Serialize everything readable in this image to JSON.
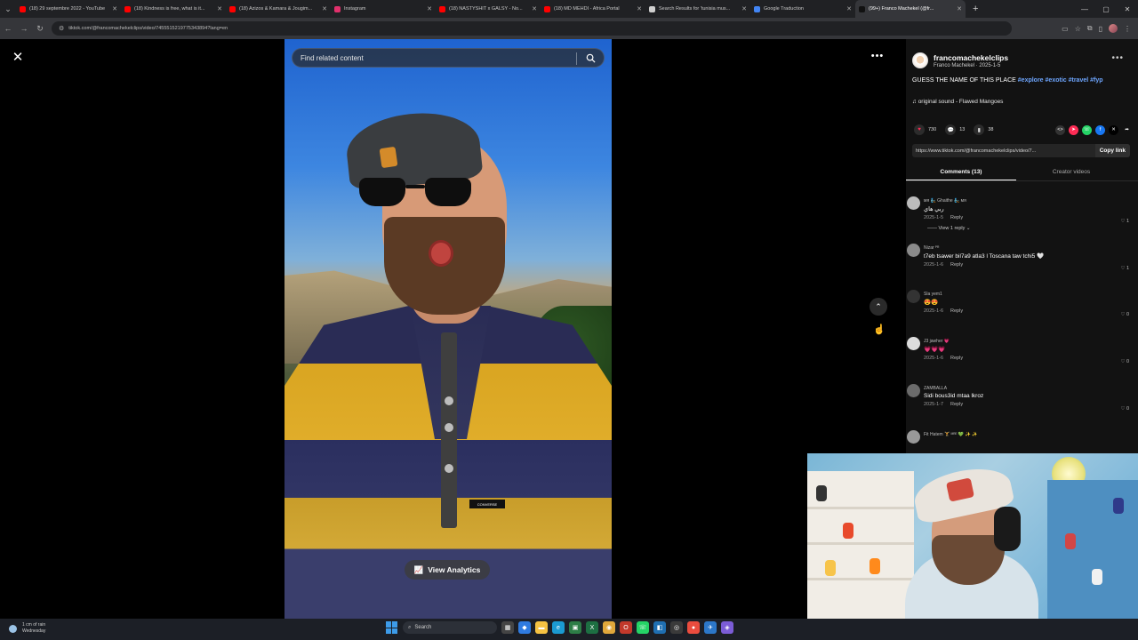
{
  "browser": {
    "tabs": [
      {
        "label": "(18) 29 septembre 2022 - YouTube",
        "color": "#ff0000"
      },
      {
        "label": "(18) Kindness is free, what is it...",
        "color": "#ff0000"
      },
      {
        "label": "(18) Azizos & Kamara & Jougim...",
        "color": "#ff0000"
      },
      {
        "label": "Instagram",
        "color": "#e1306c"
      },
      {
        "label": "(18) NASTYSHIT x GALSY - No...",
        "color": "#ff0000"
      },
      {
        "label": "(18) MD MEHDI - Africa Portal",
        "color": "#ff0000"
      },
      {
        "label": "Search Results for 'tunisia mus...",
        "color": "#cfcfcf"
      },
      {
        "label": "Google Traduction",
        "color": "#4285f4"
      },
      {
        "label": "(99+) Franco Machekel (@fr...",
        "color": "#111111"
      }
    ],
    "active_tab_index": 8,
    "url": "tiktok.com/@francomachekelclips/video/7455515219775343894?lang=en"
  },
  "video": {
    "search_placeholder": "Find related content",
    "analytics_label": "View Analytics",
    "shirt_logo": "CONVERSE"
  },
  "post": {
    "username": "francomachekelclips",
    "author_line": "Franco Machekel · 2025-1-5",
    "caption_text": "GUESS THE NAME OF THIS PLACE ",
    "hashtags": [
      "#explore",
      "#exotic",
      "#travel",
      "#fyp"
    ],
    "sound": "original sound - Flawed Mangoes",
    "likes": "730",
    "comments_count": "13",
    "saves": "38",
    "link": "https://www.tiktok.com/@francomachekelclips/video/7...",
    "copy_label": "Copy link"
  },
  "panel_tabs": {
    "comments": "Comments (13)",
    "creator": "Creator videos"
  },
  "comments": [
    {
      "name": "мя 🧞 Ghaithe 🧞 мя",
      "text": "ربي هاي",
      "date": "2025-1-5",
      "likes": "1",
      "replies": "View 1 reply"
    },
    {
      "name": "Nizar ᴾᴿ",
      "text": "t7eb tsawer bil7a9 atla3 l Toscana taw tchi5 🤍",
      "date": "2025-1-6",
      "likes": "1",
      "replies": ""
    },
    {
      "name": "Sla yem1",
      "text": "😍😍",
      "date": "2025-1-6",
      "likes": "0",
      "replies": ""
    },
    {
      "name": "J3 jawher 💗",
      "text": "💗💗💗",
      "date": "2025-1-6",
      "likes": "0",
      "replies": ""
    },
    {
      "name": "ZAMBALLA",
      "text": "Sidi bous3id mtaa lkroz",
      "date": "2025-1-7",
      "likes": "0",
      "replies": ""
    },
    {
      "name": "Fit Hatem 🏋 ᴹᴿᴱ 💚 ✨ ✨",
      "text": "",
      "date": "",
      "likes": "",
      "replies": ""
    }
  ],
  "reply_label": "Reply",
  "taskbar": {
    "weather_line1": "1 cm of rain",
    "weather_line2": "Wednesday",
    "search_label": "Search"
  },
  "colors": {
    "accent_link": "#6ea6ff",
    "like_red": "#fe2c55"
  }
}
